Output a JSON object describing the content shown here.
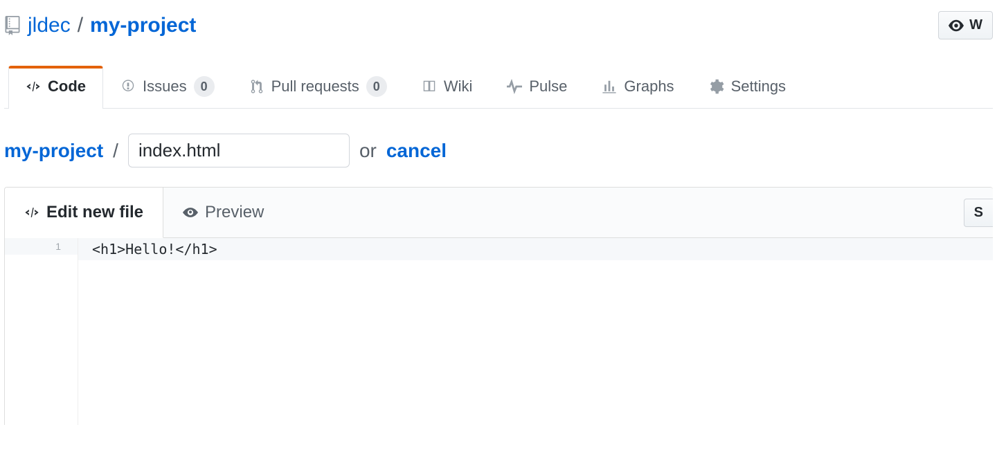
{
  "repo": {
    "owner": "jldec",
    "name": "my-project"
  },
  "watch": {
    "label": "W"
  },
  "tabs": {
    "code": "Code",
    "issues": {
      "label": "Issues",
      "count": "0"
    },
    "pulls": {
      "label": "Pull requests",
      "count": "0"
    },
    "wiki": "Wiki",
    "pulse": "Pulse",
    "graphs": "Graphs",
    "settings": "Settings"
  },
  "breadcrumb": {
    "root": "my-project",
    "slash": "/",
    "filename": "index.html",
    "or": "or",
    "cancel": "cancel"
  },
  "editor": {
    "edit_tab": "Edit new file",
    "preview_tab": "Preview",
    "spaces_btn": "S",
    "lines": [
      {
        "n": "1",
        "text": "<h1>Hello!</h1>"
      }
    ]
  }
}
